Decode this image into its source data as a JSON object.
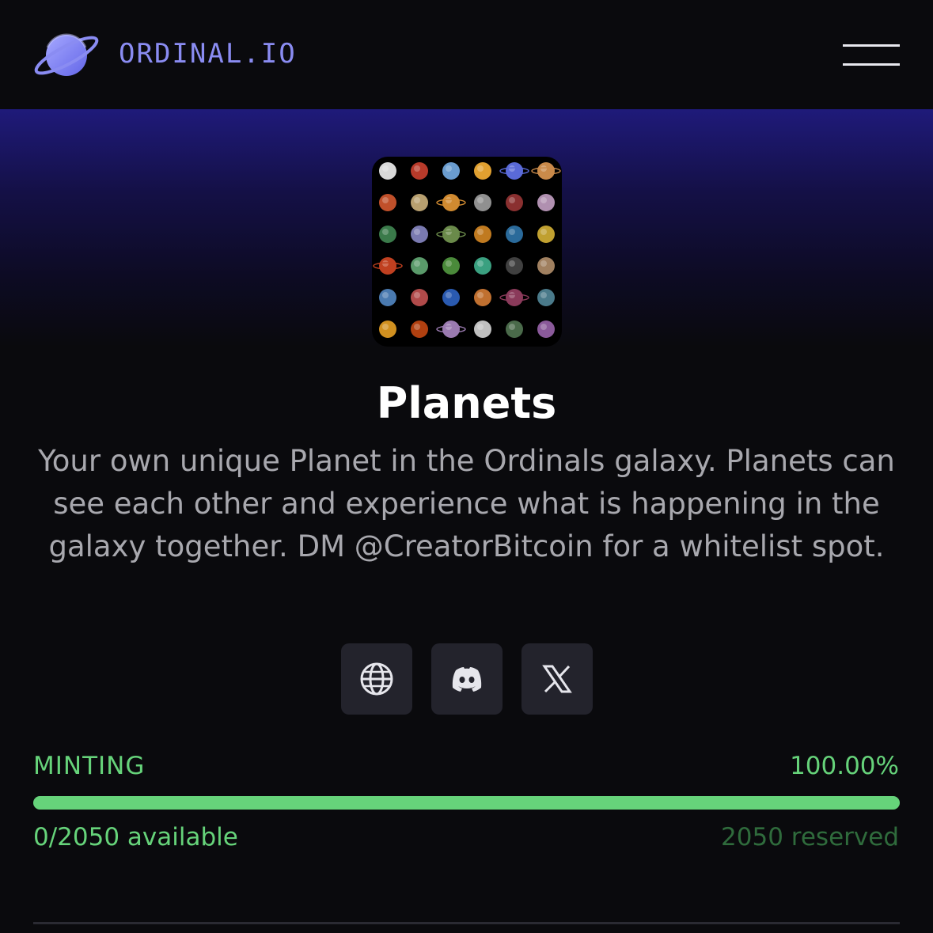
{
  "header": {
    "brand": "ORDINAL.IO",
    "logo_icon": "planet-icon",
    "menu_icon": "hamburger-menu-icon"
  },
  "collection": {
    "name": "Planets",
    "description": "Your own unique Planet in the Ordinals galaxy. Planets can see each other and experience what is happening in the galaxy together. DM @CreatorBitcoin for a whitelist spot.",
    "thumbnail_icon": "planets-grid-image"
  },
  "socials": [
    {
      "name": "website",
      "icon": "globe-icon"
    },
    {
      "name": "discord",
      "icon": "discord-icon"
    },
    {
      "name": "x",
      "icon": "x-icon"
    }
  ],
  "minting": {
    "label": "MINTING",
    "percent_text": "100.00%",
    "progress_fraction": 1.0,
    "available_text": "0/2050 available",
    "reserved_text": "2050 reserved"
  },
  "colors": {
    "accent_green": "#66d37a",
    "brand_purple": "#8a8cf2",
    "reserved_green": "#2f6b3c"
  }
}
